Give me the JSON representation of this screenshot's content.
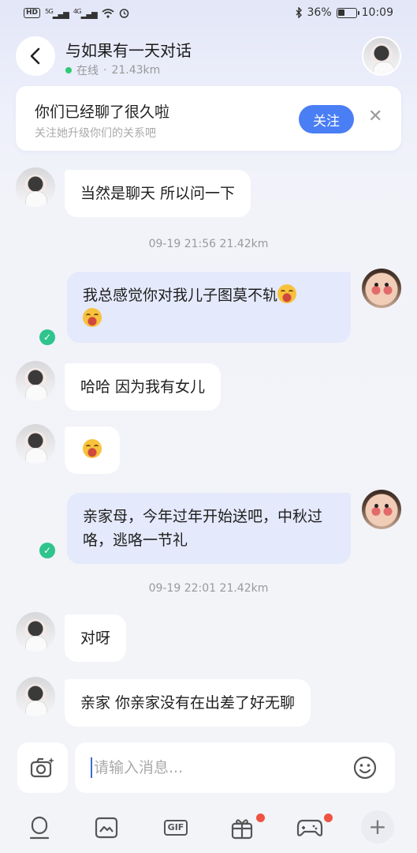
{
  "status_bar": {
    "hd_label": "HD",
    "net1": "5G",
    "net2": "4G",
    "battery": "36%",
    "battery_level": 0.36,
    "time": "10:09"
  },
  "header": {
    "title": "与如果有一天对话",
    "status": "在线",
    "distance": "21.43km"
  },
  "follow_card": {
    "title": "你们已经聊了很久啦",
    "subtitle": "关注她升级你们的关系吧",
    "button": "关注"
  },
  "messages": [
    {
      "side": "recv",
      "text": "当然是聊天 所以问一下"
    },
    {
      "type": "time",
      "text": "09-19 21:56  21.42km"
    },
    {
      "side": "sent",
      "text": "我总感觉你对我儿子图莫不轨",
      "emojis": 2,
      "read": true
    },
    {
      "side": "recv",
      "text": "哈哈 因为我有女儿"
    },
    {
      "side": "recv",
      "text": "",
      "emojis": 1
    },
    {
      "side": "sent",
      "text": "亲家母，今年过年开始送吧，中秋过咯，逃咯一节礼",
      "read": true
    },
    {
      "type": "time",
      "text": "09-19 22:01  21.42km"
    },
    {
      "side": "recv",
      "text": "对呀"
    },
    {
      "side": "recv",
      "text": "亲家 你亲家没有在出差了好无聊"
    }
  ],
  "input": {
    "placeholder": "请输入消息..."
  },
  "toolbar": {
    "gif_label": "GIF"
  },
  "colors": {
    "accent": "#4a7ef5",
    "sent_bubble": "#e4e9fb",
    "online": "#2ecc71",
    "read_check": "#2fc48d",
    "badge": "#ef5342"
  }
}
